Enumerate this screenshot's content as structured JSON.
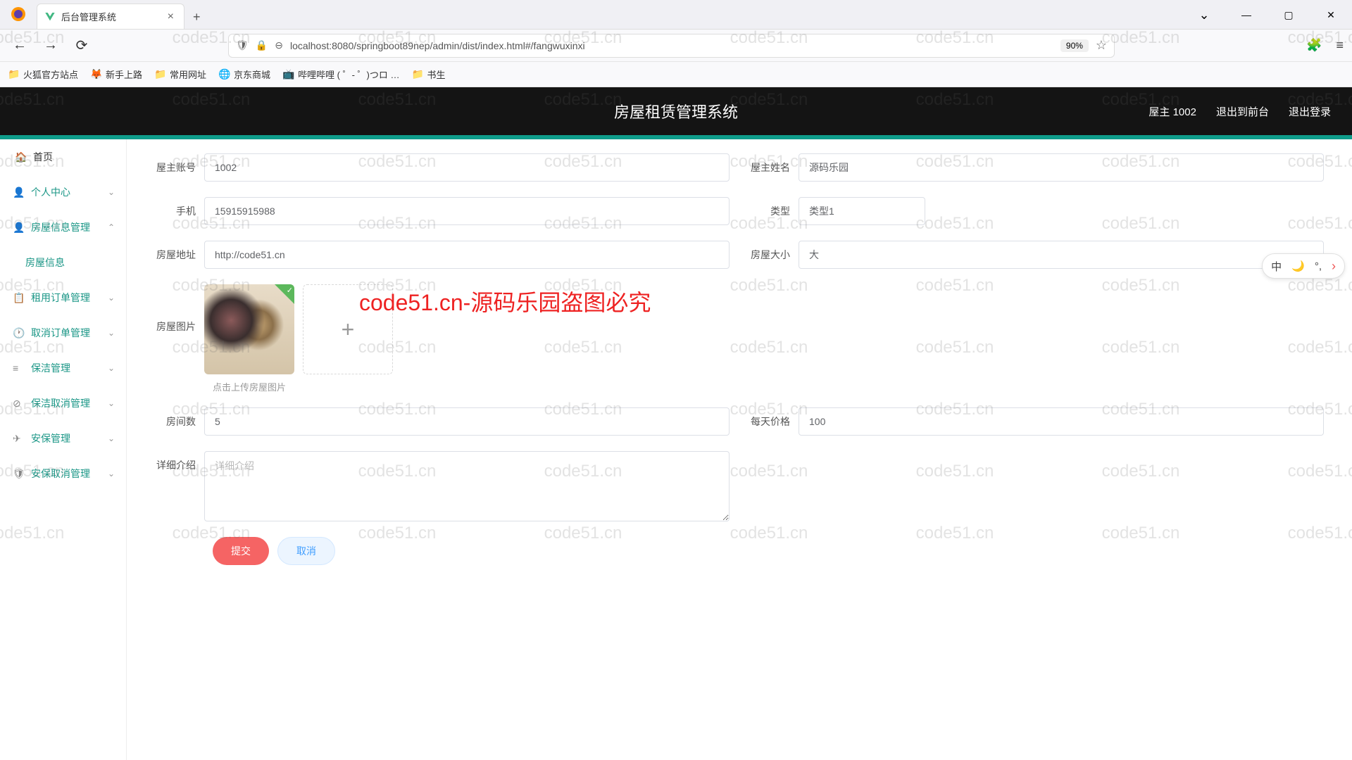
{
  "browser": {
    "tab_title": "后台管理系统",
    "url": "localhost:8080/springboot89nep/admin/dist/index.html#/fangwuxinxi",
    "zoom": "90%",
    "bookmarks": [
      "火狐官方站点",
      "新手上路",
      "常用网址",
      "京东商城",
      "哔哩哔哩 ( ゜- ゜)つロ …",
      "书生"
    ]
  },
  "header": {
    "title": "房屋租赁管理系统",
    "user": "屋主 1002",
    "links": [
      "退出到前台",
      "退出登录"
    ]
  },
  "sidebar": {
    "items": [
      {
        "icon": "🏠",
        "label": "首页",
        "kind": "home"
      },
      {
        "icon": "👤",
        "label": "个人中心",
        "expandable": true
      },
      {
        "icon": "👤",
        "label": "房屋信息管理",
        "expandable": true,
        "expanded": true
      },
      {
        "label": "房屋信息",
        "sub": true
      },
      {
        "icon": "📋",
        "label": "租用订单管理",
        "expandable": true
      },
      {
        "icon": "🕐",
        "label": "取消订单管理",
        "expandable": true
      },
      {
        "icon": "≡",
        "label": "保洁管理",
        "expandable": true
      },
      {
        "icon": "⊘",
        "label": "保洁取消管理",
        "expandable": true
      },
      {
        "icon": "✈",
        "label": "安保管理",
        "expandable": true
      },
      {
        "icon": "🛡",
        "label": "安保取消管理",
        "expandable": true
      }
    ]
  },
  "form": {
    "owner_account_label": "屋主账号",
    "owner_account": "1002",
    "owner_name_label": "屋主姓名",
    "owner_name": "源码乐园",
    "phone_label": "手机",
    "phone": "15915915988",
    "type_label": "类型",
    "type": "类型1",
    "address_label": "房屋地址",
    "address": "http://code51.cn",
    "size_label": "房屋大小",
    "size": "大",
    "image_label": "房屋图片",
    "upload_hint": "点击上传房屋图片",
    "rooms_label": "房间数",
    "rooms": "5",
    "price_label": "每天价格",
    "price": "100",
    "detail_label": "详细介绍",
    "detail_placeholder": "详细介绍",
    "submit": "提交",
    "cancel": "取消"
  },
  "watermark": {
    "text": "code51.cn",
    "big": "code51.cn-源码乐园盗图必究"
  },
  "float_pill": {
    "lang": "中"
  }
}
